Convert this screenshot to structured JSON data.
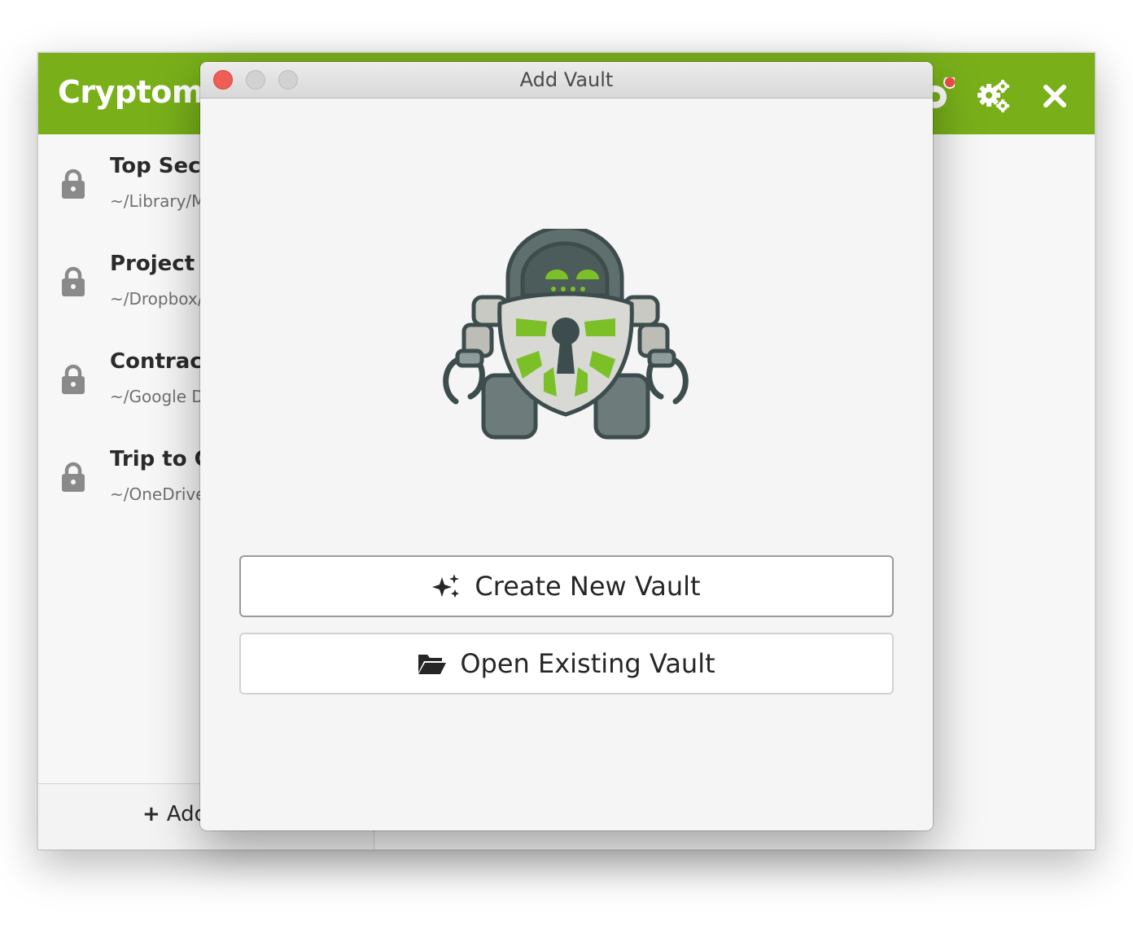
{
  "main_window": {
    "app_title": "Cryptomator",
    "header_icons": [
      "update-notification-icon",
      "settings-gears-icon",
      "close-icon"
    ],
    "accent_color": "#79b01a",
    "notification_color": "#ee4f45",
    "vaults": [
      {
        "name": "Top Secret",
        "path": "~/Library/M"
      },
      {
        "name": "Project X",
        "path": "~/Dropbox/"
      },
      {
        "name": "Contracts",
        "path": "~/Google Dr"
      },
      {
        "name": "Trip to Ca",
        "path": "~/OneDrive"
      }
    ],
    "footer": {
      "add_icon": "plus-icon",
      "add_label": "Add"
    }
  },
  "dialog": {
    "title": "Add Vault",
    "window_controls": [
      "close",
      "minimize",
      "zoom"
    ],
    "mascot": "cryptomator-robot-logo",
    "create_button": {
      "label": "Create New Vault",
      "icon": "sparkles-icon"
    },
    "open_button": {
      "label": "Open Existing Vault",
      "icon": "folder-open-icon"
    }
  }
}
